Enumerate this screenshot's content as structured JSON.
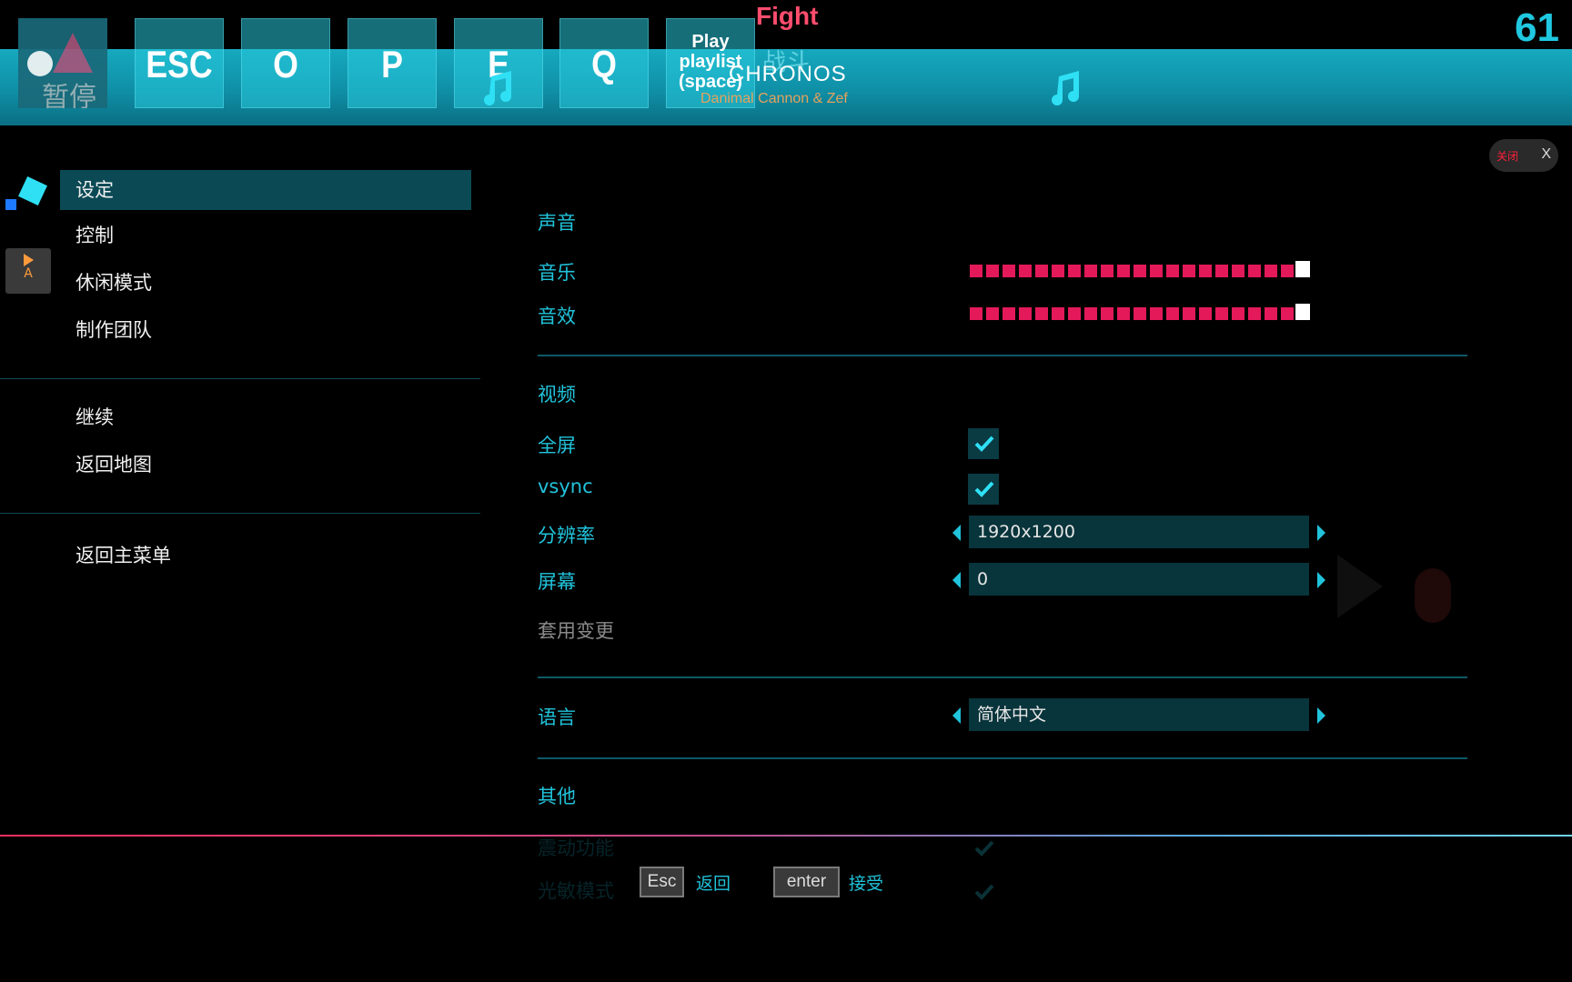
{
  "hud": {
    "pause_label": "暂停",
    "keys": [
      "ESC",
      "O",
      "P",
      "E",
      "Q"
    ],
    "play_label": "Play\nplaylist\n(space)",
    "fight_label": "Fight",
    "fight_cn": "战斗",
    "song_title": "CHRONOS",
    "song_artist": "Danimal Cannon & Zef",
    "fps": "61",
    "close_label": "关闭",
    "close_x": "X"
  },
  "menu": {
    "items": [
      "设定",
      "控制",
      "休闲模式",
      "制作团队"
    ],
    "chip_label": "A",
    "continue": "继续",
    "back_to_map": "返回地图",
    "back_to_main": "返回主菜单"
  },
  "settings": {
    "audio_header": "声音",
    "music_label": "音乐",
    "sfx_label": "音效",
    "music_volume": 1.0,
    "sfx_volume": 1.0,
    "video_header": "视频",
    "fullscreen_label": "全屏",
    "fullscreen_checked": true,
    "vsync_label": "vsync",
    "vsync_checked": true,
    "resolution_label": "分辨率",
    "resolution_value": "1920x1200",
    "screen_label": "屏幕",
    "screen_value": "0",
    "apply_label": "套用变更",
    "language_label": "语言",
    "language_value": "简体中文",
    "other_header": "其他",
    "vibration_label": "震动功能",
    "photosensitive_label": "光敏模式"
  },
  "footer": {
    "esc_key": "Esc",
    "esc_label": "返回",
    "enter_key": "enter",
    "enter_label": "接受"
  },
  "colors": {
    "accent": "#21c3db",
    "volume": "#e3195a",
    "fight": "#ff4d6d",
    "topbar": "#0f8fa6"
  }
}
